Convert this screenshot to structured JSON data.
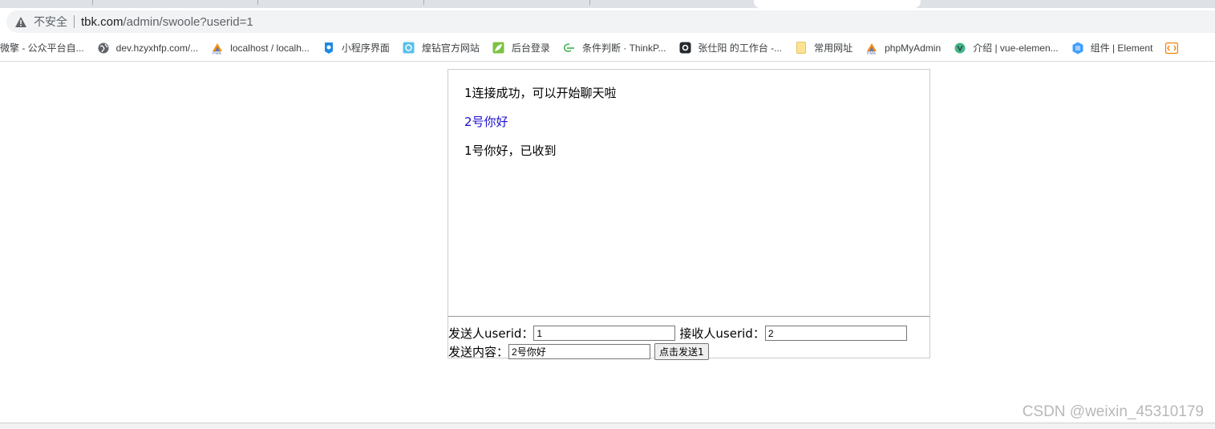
{
  "browser": {
    "security_label": "不安全",
    "url_host": "tbk.com",
    "url_path": "/admin/swoole?userid=1",
    "bookmarks": [
      {
        "label": "微擎 - 公众平台自...",
        "icon": "wechat-icon"
      },
      {
        "label": "dev.hzyxhfp.com/...",
        "icon": "globe-icon"
      },
      {
        "label": "localhost / localh...",
        "icon": "phpmyadmin-icon"
      },
      {
        "label": "小程序界面",
        "icon": "miniprogram-icon"
      },
      {
        "label": "煌钻官方网站",
        "icon": "site-icon"
      },
      {
        "label": "后台登录",
        "icon": "leaf-icon"
      },
      {
        "label": "条件判断 · ThinkP...",
        "icon": "thinkphp-icon"
      },
      {
        "label": "张仕阳 的工作台 -...",
        "icon": "github-icon"
      },
      {
        "label": "常用网址",
        "icon": "folder-icon"
      },
      {
        "label": "phpMyAdmin",
        "icon": "phpmyadmin-icon"
      },
      {
        "label": "介绍 | vue-elemen...",
        "icon": "vue-icon"
      },
      {
        "label": "组件 | Element",
        "icon": "element-icon"
      }
    ]
  },
  "chat": {
    "messages": [
      {
        "text": "1连接成功，可以开始聊天啦",
        "self": false
      },
      {
        "text": "2号你好",
        "self": true
      },
      {
        "text": "1号你好，已收到",
        "self": false
      }
    ]
  },
  "form": {
    "sender_label": "发送人userid：",
    "sender_value": "1",
    "receiver_label": "接收人userid：",
    "receiver_value": "2",
    "content_label": "发送内容：",
    "content_value": "2号你好",
    "send_button": "点击发送1"
  },
  "watermark": "CSDN @weixin_45310179",
  "colors": {
    "self_message": "#1a0dcc",
    "chrome_bg": "#dee1e6",
    "omnibox_bg": "#f1f3f4"
  }
}
